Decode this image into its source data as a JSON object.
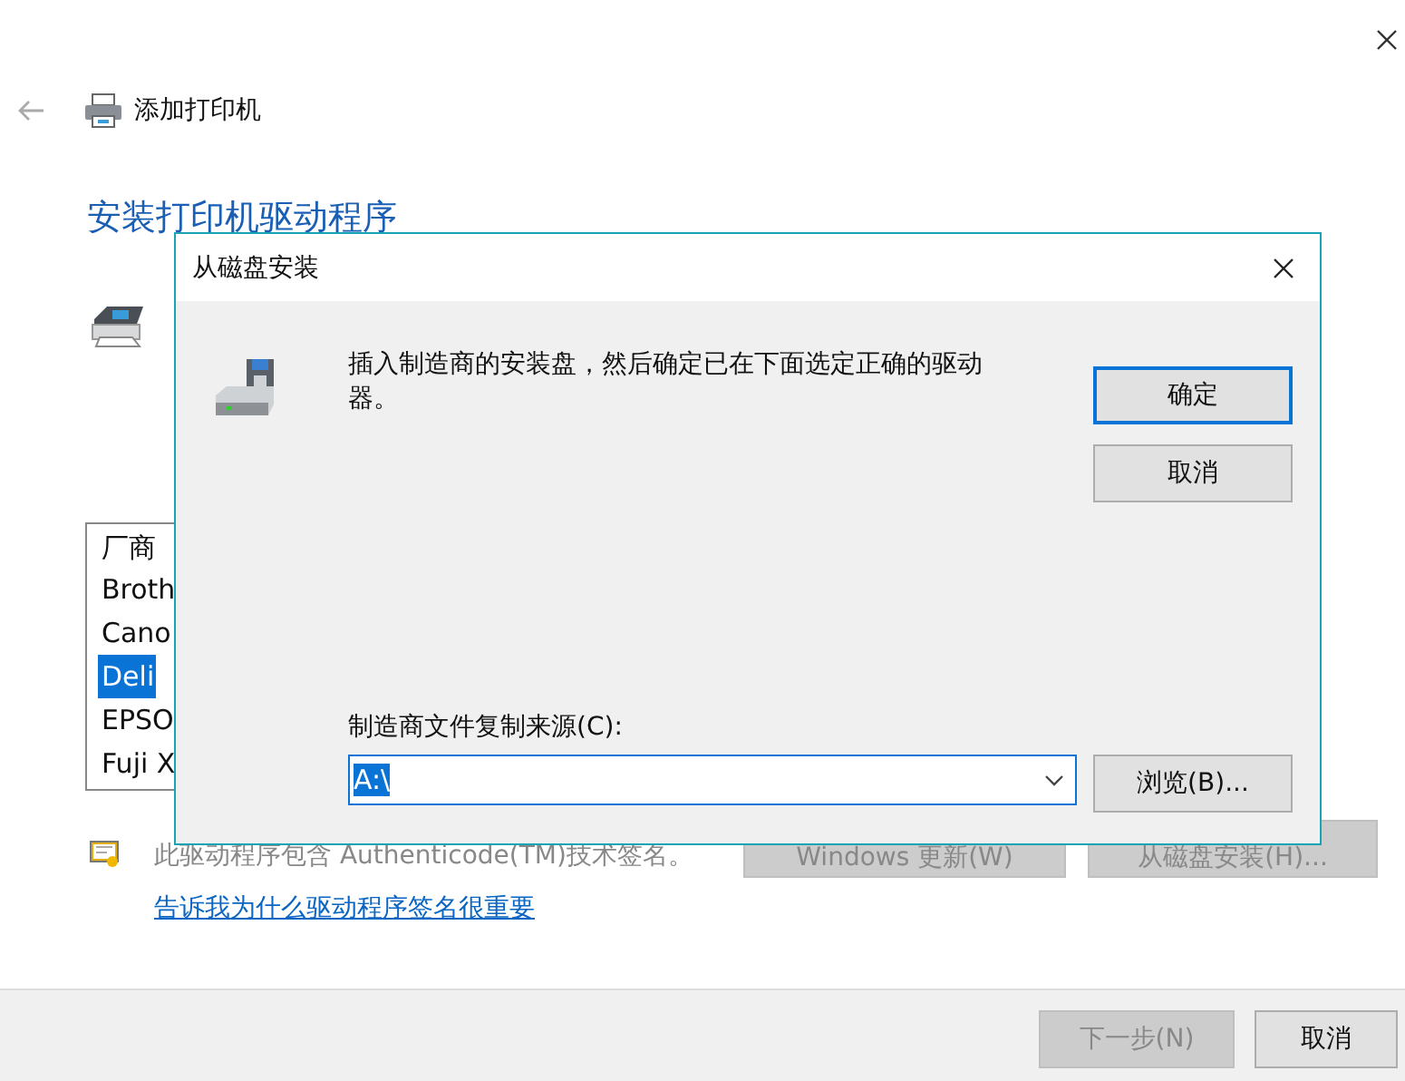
{
  "window": {
    "title": "添加打印机",
    "heading": "安装打印机驱动程序"
  },
  "manufacturer_list": {
    "header": "厂商",
    "items": [
      {
        "label": "Broth",
        "selected": false
      },
      {
        "label": "Cano",
        "selected": false
      },
      {
        "label": "Deli",
        "selected": true
      },
      {
        "label": "EPSO",
        "selected": false
      },
      {
        "label": "Fuji X",
        "selected": false
      }
    ]
  },
  "signature_note": "此驱动程序包含 Authenticode(TM)技术签名。",
  "driver_buttons": [
    {
      "label": "Windows 更新(W)",
      "disabled": true
    },
    {
      "label": "从磁盘安装(H)...",
      "disabled": true
    }
  ],
  "help_link": "告诉我为什么驱动程序签名很重要",
  "footer_buttons": [
    {
      "label": "下一步(N)",
      "disabled": true
    },
    {
      "label": "取消",
      "disabled": false
    }
  ],
  "dialog": {
    "title": "从磁盘安装",
    "message": "插入制造商的安装盘，然后确定已在下面选定正确的驱动器。",
    "buttons": [
      {
        "label": "确定",
        "default": true
      },
      {
        "label": "取消",
        "default": false
      }
    ],
    "source_label": "制造商文件复制来源(C):",
    "source_value": "A:\\",
    "source_value_highlighted": true,
    "browse_button": "浏览(B)..."
  }
}
